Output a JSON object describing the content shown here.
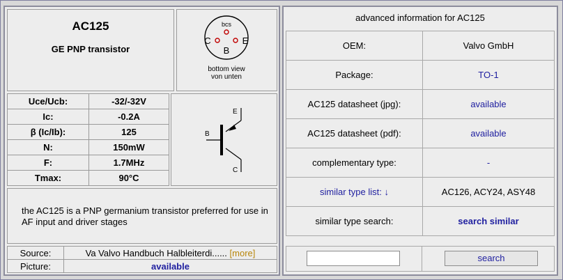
{
  "header": {
    "part": "AC125",
    "subtitle": "GE PNP transistor",
    "pin_top": "bcs",
    "pin_c": "C",
    "pin_e": "E",
    "pin_b": "B",
    "pin_caption1": "bottom view",
    "pin_caption2": "von unten"
  },
  "specs": [
    {
      "key": "Uce/Ucb:",
      "value": "-32/-32V"
    },
    {
      "key": "Ic:",
      "value": "-0.2A"
    },
    {
      "key": "β (Ic/Ib):",
      "value": "125"
    },
    {
      "key": "N:",
      "value": "150mW"
    },
    {
      "key": "F:",
      "value": "1.7MHz"
    },
    {
      "key": "Tmax:",
      "value": "90°C"
    }
  ],
  "symbol": {
    "label_e": "E",
    "label_b": "B",
    "label_c": "C"
  },
  "description": "the AC125 is a PNP germanium transistor preferred for use in AF input and driver stages",
  "source": {
    "label": "Source:",
    "value": "Va Valvo Handbuch Halbleiterdi......",
    "more": "[more]"
  },
  "picture": {
    "label": "Picture:",
    "value": "available"
  },
  "advanced": {
    "title": "advanced information for AC125",
    "rows": [
      {
        "key": "OEM:",
        "value": "Valvo GmbH"
      },
      {
        "key": "Package:",
        "value": "TO-1"
      },
      {
        "key": "AC125 datasheet (jpg):",
        "value": "available"
      },
      {
        "key": "AC125 datasheet (pdf):",
        "value": "available"
      },
      {
        "key": "complementary type:",
        "value": "-"
      },
      {
        "key": "similar type list: ↓",
        "value": "AC126, ACY24, ASY48"
      },
      {
        "key": "similar type search:",
        "value": "search similar"
      }
    ],
    "search_button": "search",
    "search_value": ""
  }
}
